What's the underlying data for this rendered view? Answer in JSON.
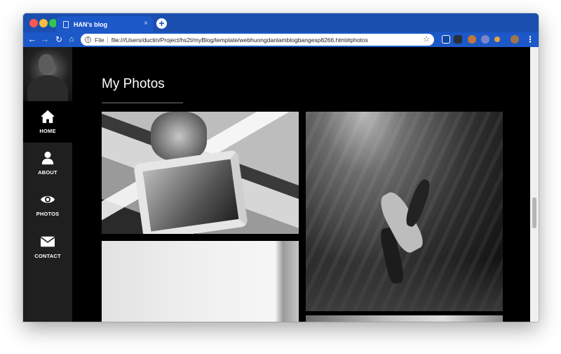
{
  "browser": {
    "tab": {
      "title": "HAN's blog",
      "close_label": "×"
    },
    "new_tab_label": "+",
    "address": {
      "scheme_label": "File",
      "url": "file:///Users/ductin/Project/hs2t/myBlog/template/webhuongdanlamblogbangesp8266.html#photos",
      "info_icon_glyph": "i"
    }
  },
  "sidebar": {
    "items": [
      {
        "label": "HOME",
        "icon": "home-icon",
        "active": true
      },
      {
        "label": "ABOUT",
        "icon": "user-icon",
        "active": false
      },
      {
        "label": "PHOTOS",
        "icon": "eye-icon",
        "active": false
      },
      {
        "label": "CONTACT",
        "icon": "envelope-icon",
        "active": false
      }
    ]
  },
  "main": {
    "title": "My Photos"
  },
  "colors": {
    "browser_chrome": "#1a4fb0",
    "toolbar": "#1d58c8",
    "page_background": "#000000",
    "sidebar_background": "#1f1f1f",
    "active_nav_background": "#000000",
    "text": "#ffffff"
  }
}
